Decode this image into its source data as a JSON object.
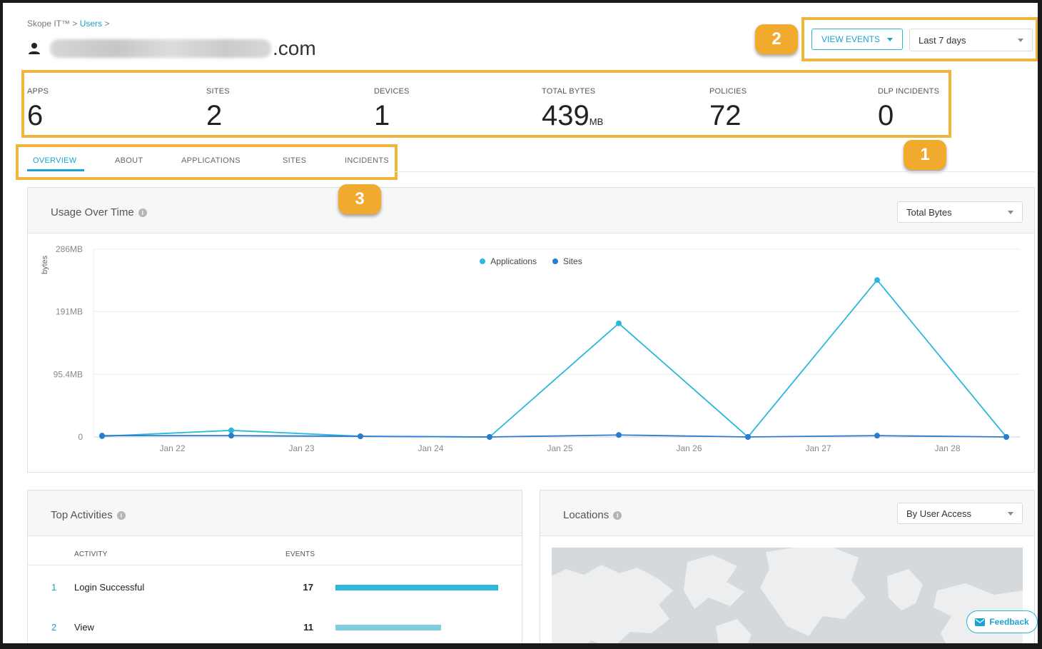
{
  "breadcrumb": {
    "root": "Skope IT™ >",
    "link": "Users",
    "sep": ">"
  },
  "user": {
    "email_visible_suffix": ".com",
    "icon": "person-icon"
  },
  "header_controls": {
    "view_events_label": "VIEW EVENTS",
    "time_range": "Last 7 days"
  },
  "badges": {
    "one": "1",
    "two": "2",
    "three": "3"
  },
  "stats": {
    "apps": {
      "label": "APPS",
      "value": "6"
    },
    "sites": {
      "label": "SITES",
      "value": "2"
    },
    "devices": {
      "label": "DEVICES",
      "value": "1"
    },
    "total_bytes": {
      "label": "TOTAL BYTES",
      "value": "439",
      "unit": "MB"
    },
    "policies": {
      "label": "POLICIES",
      "value": "72"
    },
    "dlp_incidents": {
      "label": "DLP INCIDENTS",
      "value": "0"
    }
  },
  "tabs": {
    "overview": "OVERVIEW",
    "about": "ABOUT",
    "applications": "APPLICATIONS",
    "sites": "SITES",
    "incidents": "INCIDENTS",
    "active": "overview"
  },
  "usage_card": {
    "title": "Usage Over Time",
    "metric_select": "Total Bytes"
  },
  "chart_data": {
    "type": "line",
    "title": "Usage Over Time",
    "ylabel": "bytes",
    "xlabel": "",
    "y_ticks": [
      "0",
      "95.4MB",
      "191MB",
      "286MB"
    ],
    "y_tick_values": [
      0,
      95.4,
      191,
      286
    ],
    "ylim": [
      0,
      286
    ],
    "x_tick_labels": [
      "Jan 22",
      "Jan 23",
      "Jan 24",
      "Jan 25",
      "Jan 26",
      "Jan 27",
      "Jan 28"
    ],
    "x": [
      "Jan 21",
      "Jan 22",
      "Jan 23",
      "Jan 24",
      "Jan 25",
      "Jan 26",
      "Jan 27",
      "Jan 28"
    ],
    "legend_position": "top-center",
    "grid": true,
    "series": [
      {
        "name": "Applications",
        "color": "#2bb8dc",
        "values": [
          1,
          10,
          1,
          0,
          173,
          0,
          239,
          0
        ]
      },
      {
        "name": "Sites",
        "color": "#2a7ccc",
        "values": [
          2,
          2,
          1,
          0,
          3,
          0,
          2,
          0
        ]
      }
    ]
  },
  "top_activities": {
    "title": "Top Activities",
    "col_activity": "ACTIVITY",
    "col_events": "EVENTS",
    "max_events": 17,
    "rows": [
      {
        "rank": "1",
        "activity": "Login Successful",
        "events": "17",
        "value": 17,
        "color": "#2bb8dc"
      },
      {
        "rank": "2",
        "activity": "View",
        "events": "11",
        "value": 11,
        "color": "#7fcbe0"
      }
    ]
  },
  "locations": {
    "title": "Locations",
    "select": "By User Access"
  },
  "feedback_label": "Feedback"
}
